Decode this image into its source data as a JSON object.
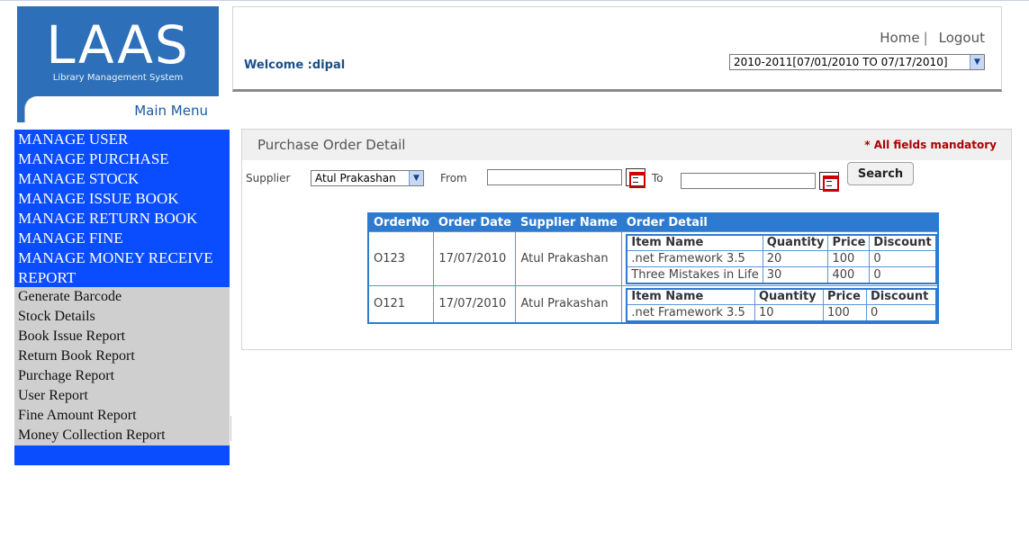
{
  "logo": {
    "mark": "LAAS",
    "subtitle": "Library Management System",
    "menu_tab": "Main Menu"
  },
  "header": {
    "welcome": "Welcome :dipal",
    "home_link": "Home",
    "separator": "|",
    "logout_link": "Logout",
    "year_select": "2010-2011[07/01/2010 TO 07/17/2010]"
  },
  "menu": {
    "primary": [
      "MANAGE USER",
      "MANAGE PURCHASE",
      "MANAGE STOCK",
      "MANAGE ISSUE BOOK",
      "MANAGE RETURN BOOK",
      "MANAGE FINE",
      "MANAGE MONEY RECEIVE",
      "REPORT"
    ],
    "reports": [
      "Generate Barcode",
      "Stock Details",
      "Book Issue Report",
      "Return Book Report",
      "Purchage Report",
      "User Report",
      "Fine Amount Report",
      "Money Collection Report"
    ]
  },
  "panel": {
    "title": "Purchase Order Detail",
    "mandatory": "* All fields mandatory",
    "supplier_label": "Supplier",
    "supplier_value": "Atul Prakashan",
    "from_label": "From",
    "to_label": "To",
    "search_label": "Search"
  },
  "grid": {
    "headers": [
      "OrderNo",
      "Order Date",
      "Supplier Name",
      "Order Detail"
    ],
    "detail_headers": [
      "Item Name",
      "Quantity",
      "Price",
      "Discount"
    ],
    "rows": [
      {
        "order_no": "O123",
        "date": "17/07/2010",
        "supplier": "Atul Prakashan",
        "items": [
          {
            "name": ".net Framework 3.5",
            "qty": "20",
            "price": "100",
            "discount": "0"
          },
          {
            "name": "Three Mistakes in Life",
            "qty": "30",
            "price": "400",
            "discount": "0"
          }
        ]
      },
      {
        "order_no": "O121",
        "date": "17/07/2010",
        "supplier": "Atul Prakashan",
        "items": [
          {
            "name": ".net Framework 3.5",
            "qty": "10",
            "price": "100",
            "discount": "0"
          }
        ]
      }
    ]
  },
  "colors": {
    "menu_blue": "#0a4cff",
    "grid_blue": "#2d7bd0",
    "logo_blue": "#2d6fb8",
    "mandatory_red": "#b00000"
  }
}
